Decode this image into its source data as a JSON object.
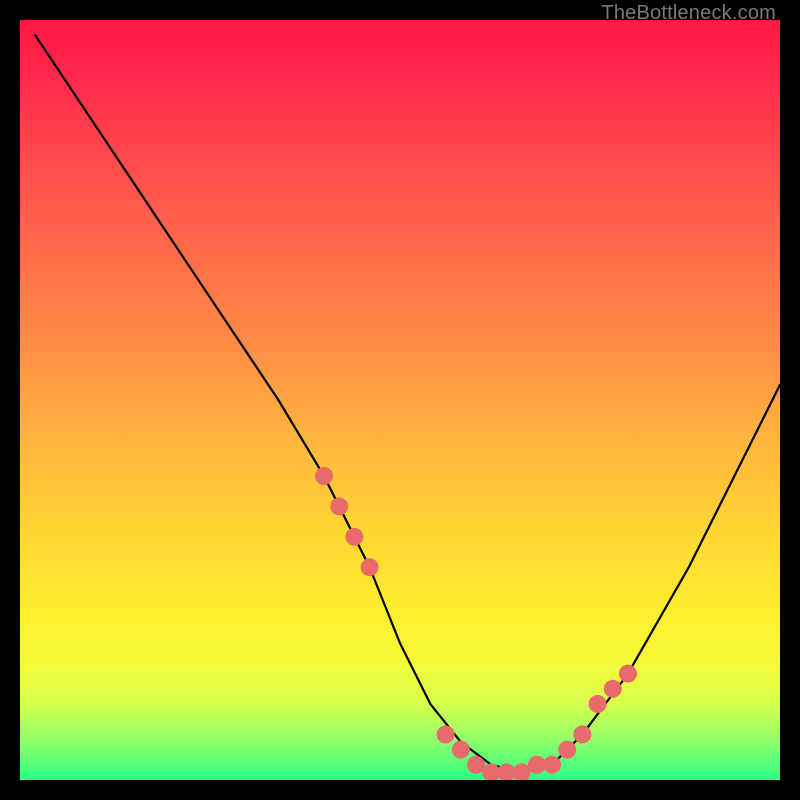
{
  "watermark": "TheBottleneck.com",
  "chart_data": {
    "type": "line",
    "title": "",
    "xlabel": "",
    "ylabel": "",
    "xlim": [
      0,
      100
    ],
    "ylim": [
      0,
      100
    ],
    "series": [
      {
        "name": "bottleneck-curve",
        "x": [
          2,
          10,
          18,
          26,
          34,
          40,
          46,
          50,
          54,
          58,
          62,
          66,
          70,
          74,
          80,
          88,
          96,
          100
        ],
        "values": [
          98,
          86,
          74,
          62,
          50,
          40,
          28,
          18,
          10,
          5,
          2,
          1,
          2,
          6,
          14,
          28,
          44,
          52
        ]
      }
    ],
    "markers": {
      "name": "highlight-dots",
      "color": "#e86a6a",
      "radius_px": 9,
      "x": [
        40,
        42,
        44,
        46,
        56,
        58,
        60,
        62,
        64,
        66,
        68,
        70,
        72,
        74,
        76,
        78,
        80
      ],
      "values": [
        40,
        36,
        32,
        28,
        6,
        4,
        2,
        1,
        1,
        1,
        2,
        2,
        4,
        6,
        10,
        12,
        14
      ]
    },
    "gradient_stops": [
      {
        "pos": 0.0,
        "color": "#ff1846"
      },
      {
        "pos": 0.18,
        "color": "#ff4a4e"
      },
      {
        "pos": 0.42,
        "color": "#ff8a46"
      },
      {
        "pos": 0.68,
        "color": "#ffd733"
      },
      {
        "pos": 0.85,
        "color": "#f4fb3a"
      },
      {
        "pos": 1.0,
        "color": "#2bff85"
      }
    ]
  }
}
